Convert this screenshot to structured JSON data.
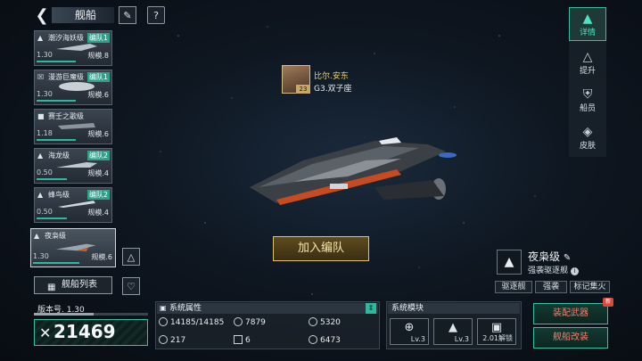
{
  "header": {
    "title": "舰船"
  },
  "ships": [
    {
      "name": "潮汐海妖级",
      "fleet": "编队1",
      "level": "1.30",
      "scale": "规模.8"
    },
    {
      "name": "漫游巨魔级",
      "fleet": "编队1",
      "level": "1.30",
      "scale": "规模.6"
    },
    {
      "name": "赛壬之歌级",
      "fleet": "",
      "level": "1.18",
      "scale": "规模.6"
    },
    {
      "name": "海龙级",
      "fleet": "编队2",
      "level": "0.50",
      "scale": "规模.4"
    },
    {
      "name": "蜂鸟级",
      "fleet": "编队2",
      "level": "0.50",
      "scale": "规模.4"
    },
    {
      "name": "夜枭级",
      "fleet": "",
      "level": "1.30",
      "scale": "规模.6"
    }
  ],
  "ship_list_button": "舰船列表",
  "pilot": {
    "name": "比尔.安东",
    "rank": "G3.双子座",
    "level": "23"
  },
  "join_button": "加入编队",
  "right_nav": [
    {
      "label": "详情",
      "icon": "detail-icon",
      "active": true
    },
    {
      "label": "提升",
      "icon": "upgrade-icon",
      "active": false
    },
    {
      "label": "船员",
      "icon": "crew-icon",
      "active": false
    },
    {
      "label": "皮肤",
      "icon": "skin-icon",
      "active": false
    }
  ],
  "selected_ship": {
    "name": "夜枭级",
    "type": "强袭驱逐舰",
    "tags": [
      "驱逐舰",
      "强袭",
      "标记集火"
    ]
  },
  "version": {
    "label": "版本号. 1.30",
    "progress": 0.52
  },
  "power": "21469",
  "attributes": {
    "title": "系统属性",
    "items": [
      {
        "value": "14185/14185",
        "icon": "hull-icon"
      },
      {
        "value": "7879",
        "icon": "attack-icon"
      },
      {
        "value": "5320",
        "icon": "defense-icon"
      },
      {
        "value": "217",
        "icon": "speed-icon"
      },
      {
        "value": "6",
        "icon": "grid-icon"
      },
      {
        "value": "6473",
        "icon": "energy-icon"
      }
    ]
  },
  "modules": {
    "title": "系统模块",
    "items": [
      {
        "label": "Lv.3",
        "icon": "target-icon"
      },
      {
        "label": "Lv.3",
        "icon": "engine-icon"
      },
      {
        "label": "2.01解锁",
        "icon": "lock-icon"
      }
    ]
  },
  "actions": {
    "equip": "装配武器",
    "modify": "舰船改装",
    "new_badge": "新"
  }
}
